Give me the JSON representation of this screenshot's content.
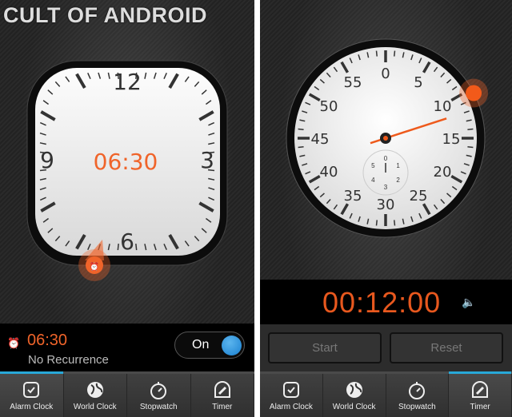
{
  "watermark": "CULT OF ANDROID",
  "accent": "#f0642a",
  "alarm": {
    "clock_labels": [
      "12",
      "3",
      "6",
      "9"
    ],
    "center_time": "06:30",
    "alarm_hour_marker_time": "06:30",
    "time": "06:30",
    "recurrence": "No Recurrence",
    "toggle_label": "On",
    "toggle_on": true
  },
  "timer": {
    "dial_labels": [
      "0",
      "5",
      "10",
      "15",
      "20",
      "25",
      "30",
      "35",
      "40",
      "45",
      "50",
      "55"
    ],
    "subdial_labels": [
      "0",
      "1",
      "2",
      "3",
      "4",
      "5"
    ],
    "minutes_set": 12,
    "time": "00:12:00",
    "start_label": "Start",
    "reset_label": "Reset"
  },
  "tabs": [
    {
      "label": "Alarm Clock",
      "icon": "alarm-clock-icon"
    },
    {
      "label": "World Clock",
      "icon": "globe-icon"
    },
    {
      "label": "Stopwatch",
      "icon": "stopwatch-icon"
    },
    {
      "label": "Timer",
      "icon": "timer-icon"
    }
  ],
  "left_active_tab": 0,
  "right_active_tab": 3
}
